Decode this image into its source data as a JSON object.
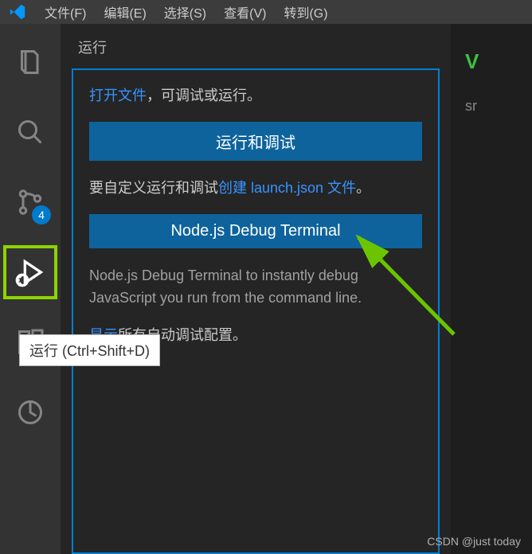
{
  "menu": {
    "file": "文件(F)",
    "edit": "编辑(E)",
    "select": "选择(S)",
    "view": "查看(V)",
    "go": "转到(G)"
  },
  "activity": {
    "scm_badge": "4",
    "tooltip": "运行 (Ctrl+Shift+D)"
  },
  "sidebar": {
    "title": "运行",
    "open_file_link": "打开文件",
    "open_file_suffix": "，可调试或运行。",
    "run_debug_btn": "运行和调试",
    "customize_prefix": "要自定义运行和调试",
    "create_link": "创建 launch.json 文件",
    "customize_suffix": "。",
    "node_btn": "Node.js Debug Terminal",
    "node_desc_prefix": "",
    "node_desc": " Node.js Debug Terminal to instantly debug JavaScript you run from the command line.",
    "show_link": "显示",
    "show_suffix": "所有自动调试配置。"
  },
  "right": {
    "src": "sr"
  },
  "watermark": "CSDN @just today"
}
